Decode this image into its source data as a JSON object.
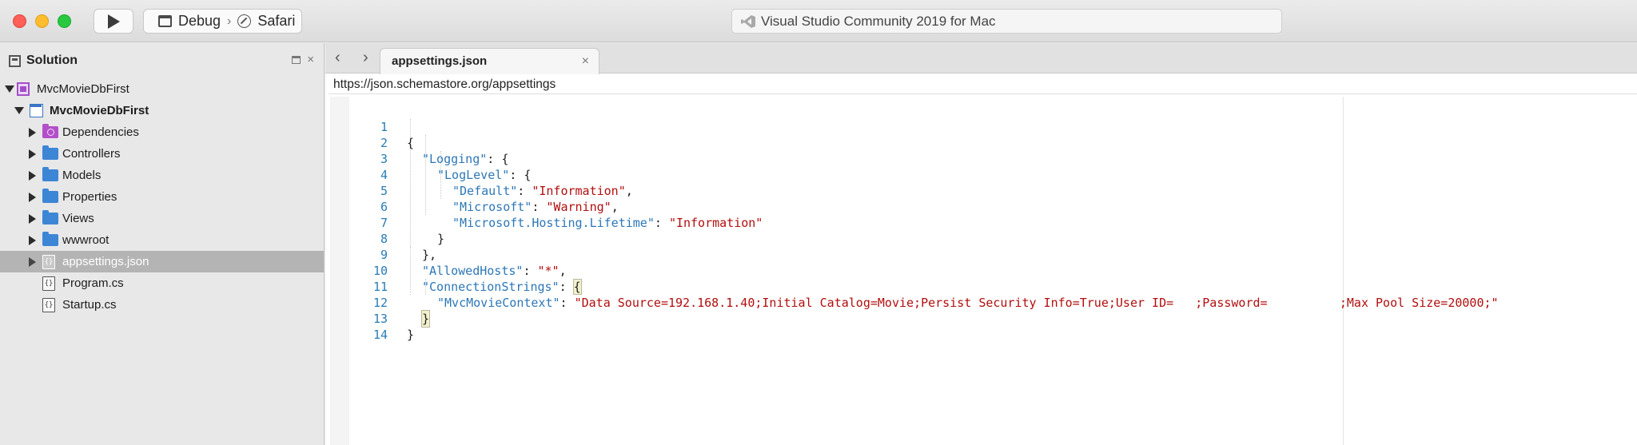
{
  "window": {
    "title": "Visual Studio Community 2019 for Mac",
    "config": "Debug",
    "separator": "›",
    "target": "Safari"
  },
  "solution_pad": {
    "title": "Solution",
    "items": [
      {
        "label": "MvcMovieDbFirst",
        "icon": "solution-icon",
        "expand": "down"
      },
      {
        "label": "MvcMovieDbFirst",
        "icon": "project-icon",
        "expand": "down"
      },
      {
        "label": "Dependencies",
        "icon": "dependencies-folder-icon",
        "expand": "right"
      },
      {
        "label": "Controllers",
        "icon": "folder-icon",
        "expand": "right"
      },
      {
        "label": "Models",
        "icon": "folder-icon",
        "expand": "right"
      },
      {
        "label": "Properties",
        "icon": "folder-icon",
        "expand": "right"
      },
      {
        "label": "Views",
        "icon": "folder-icon",
        "expand": "right"
      },
      {
        "label": "wwwroot",
        "icon": "folder-icon",
        "expand": "right"
      },
      {
        "label": "appsettings.json",
        "icon": "json-file-icon",
        "expand": "right"
      },
      {
        "label": "Program.cs",
        "icon": "cs-file-icon",
        "expand": "none"
      },
      {
        "label": "Startup.cs",
        "icon": "cs-file-icon",
        "expand": "none"
      }
    ],
    "selected": "appsettings.json"
  },
  "editor": {
    "tab_label": "appsettings.json",
    "tab_close": "×",
    "nav_back": "‹",
    "nav_forward": "›",
    "schema_url": "https://json.schemastore.org/appsettings",
    "line_numbers": [
      "1",
      "2",
      "3",
      "4",
      "5",
      "6",
      "7",
      "8",
      "9",
      "10",
      "11",
      "12",
      "13",
      "14"
    ],
    "lines": {
      "l1": "{",
      "l2_key": "\"Logging\"",
      "l2_rest": ": {",
      "l3_key": "\"LogLevel\"",
      "l3_rest": ": {",
      "l4_key": "\"Default\"",
      "l4_sep": ": ",
      "l4_val": "\"Information\"",
      "l4_end": ",",
      "l5_key": "\"Microsoft\"",
      "l5_sep": ": ",
      "l5_val": "\"Warning\"",
      "l5_end": ",",
      "l6_key": "\"Microsoft.Hosting.Lifetime\"",
      "l6_sep": ": ",
      "l6_val": "\"Information\"",
      "l7": "}",
      "l8": "},",
      "l9_key": "\"AllowedHosts\"",
      "l9_sep": ": ",
      "l9_val": "\"*\"",
      "l9_end": ",",
      "l10_key": "\"ConnectionStrings\"",
      "l10_sep": ": ",
      "l10_brace": "{",
      "l11_key": "\"MvcMovieContext\"",
      "l11_sep": ": ",
      "l11_val": "\"Data Source=192.168.1.40;Initial Catalog=Movie;Persist Security Info=True;User ID=   ;Password=          ;Max Pool Size=20000;\"",
      "l12": "}",
      "l13": "}"
    }
  }
}
